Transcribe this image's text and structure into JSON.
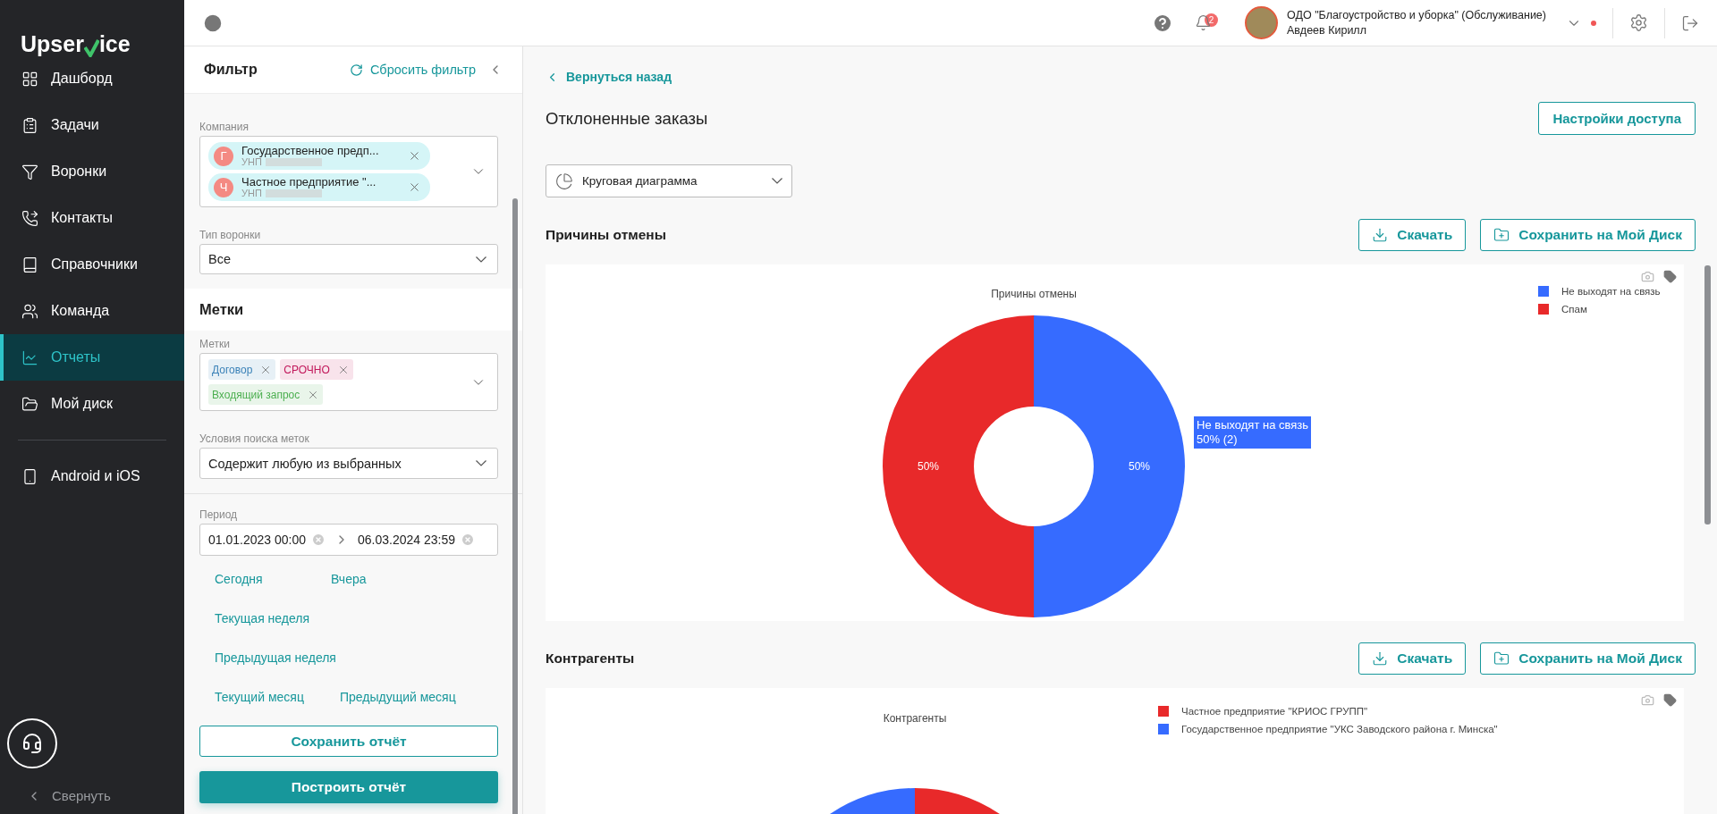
{
  "sidebar": {
    "logo": {
      "before": "Upser",
      "after": "ice"
    },
    "nav": [
      {
        "label": "Дашборд",
        "selected": false
      },
      {
        "label": "Задачи",
        "selected": false
      },
      {
        "label": "Воронки",
        "selected": false
      },
      {
        "label": "Контакты",
        "selected": false
      },
      {
        "label": "Справочники",
        "selected": false
      },
      {
        "label": "Команда",
        "selected": false
      },
      {
        "label": "Отчеты",
        "selected": true
      },
      {
        "label": "Мой диск",
        "selected": false
      }
    ],
    "nav_extra": [
      {
        "label": "Android и iOS",
        "selected": false
      }
    ],
    "collapse": "Свернуть"
  },
  "topbar": {
    "notifications": "2",
    "organization": "ОДО \"Благоустройство и уборка\" (Обслуживание)",
    "user": "Авдеев Кирилл"
  },
  "filter": {
    "title": "Фильтр",
    "reset": "Сбросить фильтр",
    "company": {
      "label": "Компания",
      "chips": [
        {
          "initial": "Г",
          "name": "Государственное предп...",
          "unp": "УНП"
        },
        {
          "initial": "Ч",
          "name": "Частное предприятие \"...",
          "unp": "УНП"
        }
      ]
    },
    "funnel_type": {
      "label": "Тип воронки",
      "value": "Все"
    },
    "tags_heading": "Метки",
    "tags": {
      "label": "Метки",
      "chips": [
        {
          "text": "Договор",
          "color": "#3b82b8"
        },
        {
          "text": "СРОЧНО",
          "color": "#c2185b"
        },
        {
          "text": "Входящий запрос",
          "color": "#4caf50"
        }
      ]
    },
    "search_condition": {
      "label": "Условия поиска меток",
      "value": "Содержит любую из выбранных"
    },
    "period": {
      "label": "Период",
      "from": "01.01.2023 00:00",
      "to": "06.03.2024 23:59"
    },
    "quick_ranges": [
      [
        "Сегодня",
        "Вчера"
      ],
      [
        "Текущая неделя"
      ],
      [
        "Предыдущая неделя"
      ],
      [
        "Текущий месяц",
        "Предыдущий месяц"
      ]
    ],
    "save_button": "Сохранить отчёт",
    "build_button": "Построить отчёт"
  },
  "main": {
    "back": "Вернуться назад",
    "title": "Отклоненные заказы",
    "access_button": "Настройки доступа",
    "chart_type": "Круговая диаграмма",
    "sections": [
      {
        "title": "Причины отмены",
        "download": "Скачать",
        "save": "Сохранить на Мой Диск",
        "tooltip": {
          "label": "Не выходят на связь",
          "value": "50% (2)"
        },
        "chart_data": {
          "type": "donut",
          "title": "Причины отмены",
          "categories": [
            "Не выходят на связь",
            "Спам"
          ],
          "values": [
            50,
            50
          ],
          "colors": [
            "#366bff",
            "#e8292a"
          ],
          "value_labels": [
            "50%",
            "50%"
          ],
          "legend": true
        }
      },
      {
        "title": "Контрагенты",
        "download": "Скачать",
        "save": "Сохранить на Мой Диск",
        "chart_title": "Контрагенты",
        "legend": [
          {
            "label": "Частное предприятие \"КРИОС ГРУПП\"",
            "color": "#e8292a"
          },
          {
            "label": "Государственное предприятие \"УКС Заводского района г. Минска\"",
            "color": "#366bff"
          }
        ]
      }
    ]
  }
}
